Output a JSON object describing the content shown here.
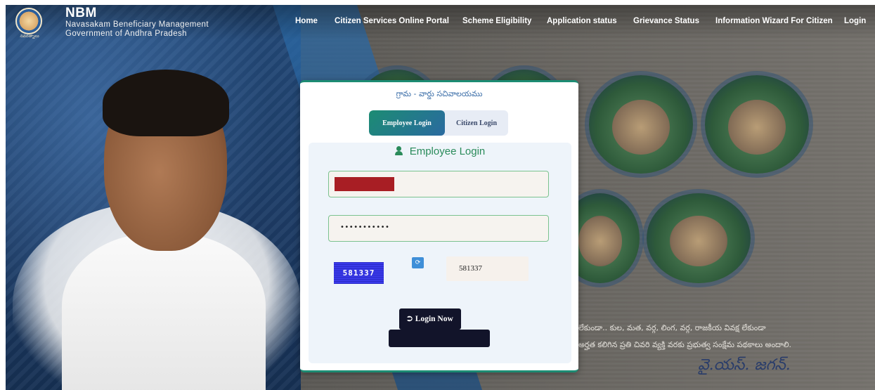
{
  "brand": {
    "title": "NBM",
    "subtitle_line1": "Navasakam Beneficiary Management",
    "subtitle_line2": "Government of Andhra Pradesh",
    "logo_caption": "నవరత్నాలు"
  },
  "nav": {
    "items": [
      "Home",
      "Citizen Services Online Portal",
      "Scheme Eligibility",
      "Application status",
      "Grievance Status",
      "Information Wizard For Citizen",
      "Login"
    ]
  },
  "card": {
    "header": "గ్రామ - వార్డు సచివాలయము",
    "tabs": {
      "employee": "Employee Login",
      "citizen": "Citizen Login"
    },
    "panel_title": "Employee Login",
    "password_mask": "•••••••••••",
    "captcha_text": "581337",
    "captcha_value": "581337",
    "refresh_icon": "⟳",
    "login_label": "Login Now"
  },
  "background": {
    "telugu_line1": "లేకుండా.. కుల, మత, వర్గ, లింగ, వర్గ, రాజకీయ వివక్ష లేకుండా",
    "telugu_line2": "అర్హత కలిగిన ప్రతి చివరి వ్యక్తి వరకు ప్రభుత్వ సంక్షేమ పథకాలు అందాలి.",
    "signature": "వై.యస్. జగన్."
  },
  "colors": {
    "accent_green": "#1c8c73",
    "tab_blue": "#2a6aa0",
    "button_dark": "#12142a",
    "redaction": "#a81e24"
  }
}
